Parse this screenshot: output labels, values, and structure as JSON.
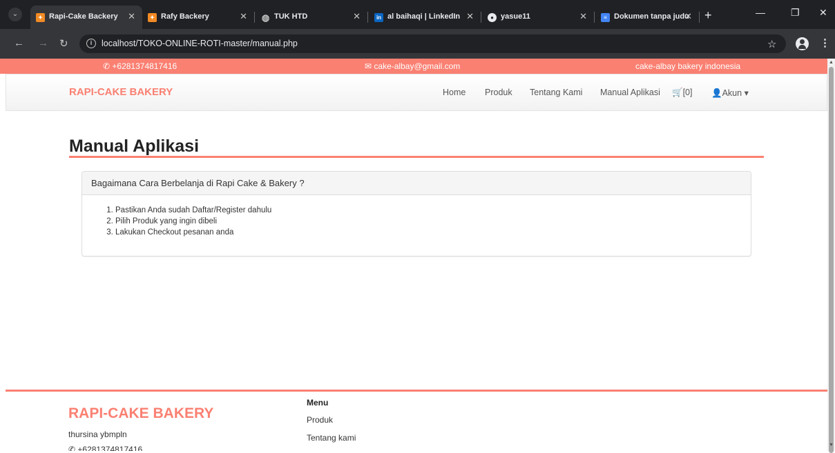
{
  "browser": {
    "tabs": [
      {
        "title": "Rapi-Cake Backery",
        "icon": "cake-favicon-icon",
        "active": true
      },
      {
        "title": "Rafy Backery",
        "icon": "cake-favicon-icon",
        "active": false
      },
      {
        "title": "TUK HTD",
        "icon": "globe-icon",
        "active": false
      },
      {
        "title": "al baihaqi | LinkedIn",
        "icon": "linkedin-icon",
        "active": false
      },
      {
        "title": "yasue11",
        "icon": "github-icon",
        "active": false
      },
      {
        "title": "Dokumen tanpa judu",
        "icon": "docs-icon",
        "active": false
      }
    ],
    "address": "localhost/TOKO-ONLINE-ROTI-master/manual.php"
  },
  "topbar": {
    "phone": "+6281374817416",
    "email": "cake-albay@gmail.com",
    "tagline": "cake-albay bakery indonesia"
  },
  "navbar": {
    "brand": "RAPI-CAKE BAKERY",
    "links": {
      "home": "Home",
      "produk": "Produk",
      "tentang": "Tentang Kami",
      "manual": "Manual Aplikasi",
      "cart": "[0]",
      "akun": "Akun"
    }
  },
  "main": {
    "title": "Manual Aplikasi",
    "panel": {
      "heading": "Bagaimana Cara Berbelanja di Rapi Cake & Bakery ?",
      "steps": [
        "Pastikan Anda sudah Daftar/Register dahulu",
        "Pilih Produk yang ingin dibeli",
        "Lakukan Checkout pesanan anda"
      ]
    }
  },
  "footer": {
    "brand": "RAPI-CAKE BAKERY",
    "address": "thursina ybmpln",
    "phone": "+6281374817416",
    "menu_heading": "Menu",
    "menu_links": [
      "Produk",
      "Tentang kami"
    ]
  },
  "colors": {
    "accent": "#fa8072",
    "chrome_dark": "#202124",
    "chrome_toolbar": "#35363a"
  }
}
